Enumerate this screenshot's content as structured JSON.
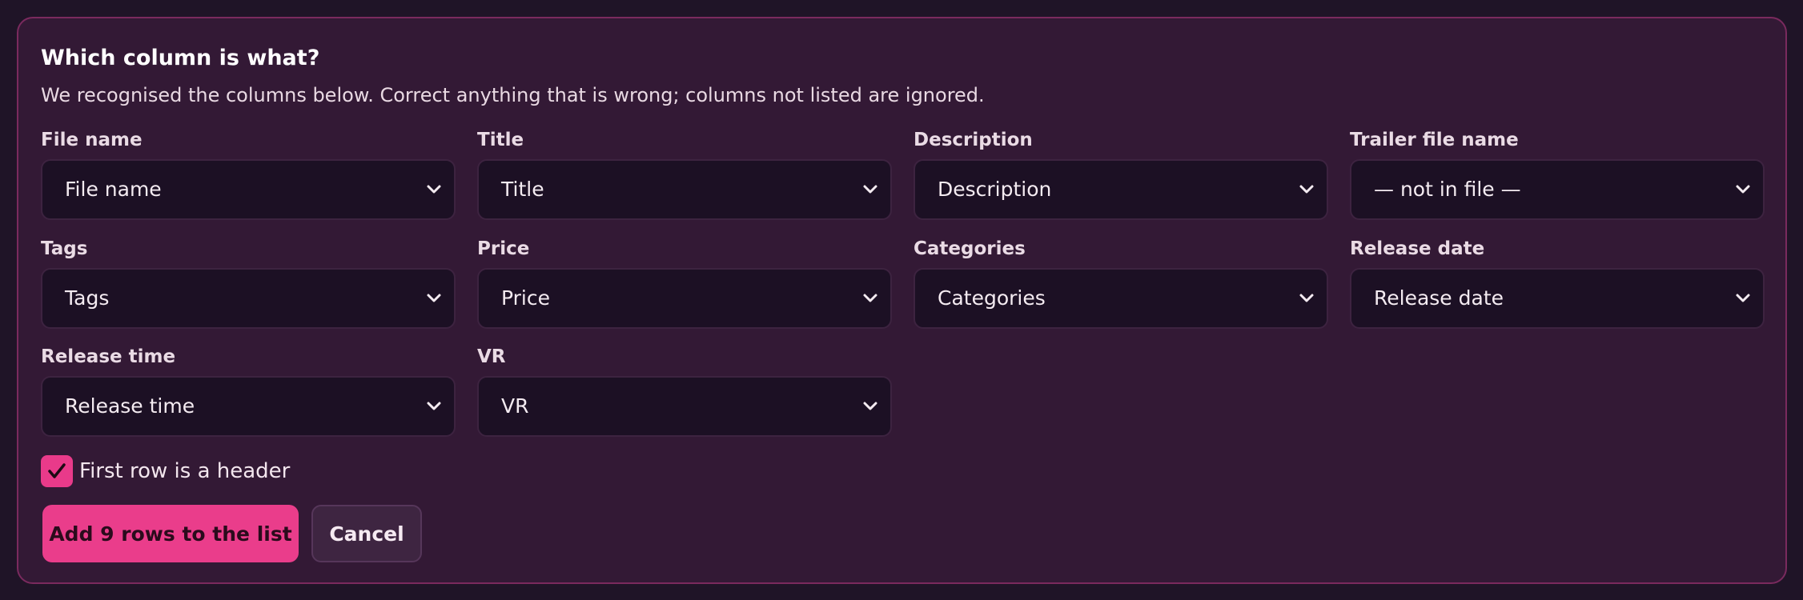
{
  "dialog": {
    "title": "Which column is what?",
    "description": "We recognised the columns below. Correct anything that is wrong; columns not listed are ignored."
  },
  "mappings": [
    {
      "label": "File name",
      "value": "File name"
    },
    {
      "label": "Title",
      "value": "Title"
    },
    {
      "label": "Description",
      "value": "Description"
    },
    {
      "label": "Trailer file name",
      "value": "— not in file —"
    },
    {
      "label": "Tags",
      "value": "Tags"
    },
    {
      "label": "Price",
      "value": "Price"
    },
    {
      "label": "Categories",
      "value": "Categories"
    },
    {
      "label": "Release date",
      "value": "Release date"
    },
    {
      "label": "Release time",
      "value": "Release time"
    },
    {
      "label": "VR",
      "value": "VR"
    }
  ],
  "header_checkbox": {
    "label": "First row is a header",
    "checked": true
  },
  "actions": {
    "primary_label": "Add 9 rows to the list",
    "cancel_label": "Cancel"
  },
  "colors": {
    "accent": "#ea3d8b",
    "panel_bg": "#331935",
    "page_bg": "#1f1427",
    "select_bg": "#1c1024"
  },
  "icons": {
    "dropdown": "chevron-down-icon",
    "checkbox": "check-icon"
  }
}
